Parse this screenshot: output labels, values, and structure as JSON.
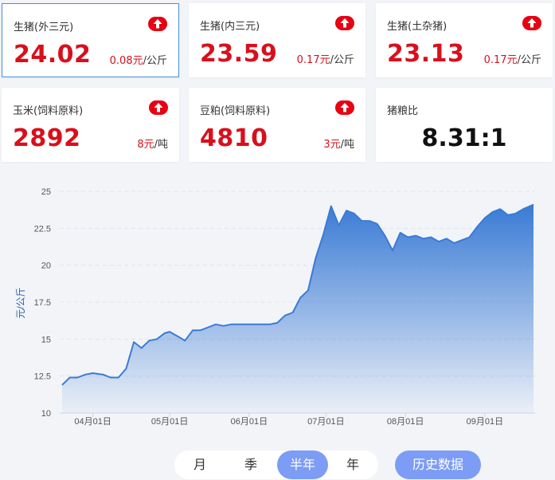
{
  "cards": [
    {
      "name": "生猪(外三元)",
      "price": "24.02",
      "change": "0.08元",
      "unit": "/公斤",
      "trend": "up",
      "selected": true
    },
    {
      "name": "生猪(内三元)",
      "price": "23.59",
      "change": "0.17元",
      "unit": "/公斤",
      "trend": "up"
    },
    {
      "name": "生猪(土杂猪)",
      "price": "23.13",
      "change": "0.17元",
      "unit": "/公斤",
      "trend": "up"
    },
    {
      "name": "玉米(饲料原料)",
      "price": "2892",
      "change": "8元",
      "unit": "/吨",
      "trend": "up"
    },
    {
      "name": "豆粕(饲料原料)",
      "price": "4810",
      "change": "3元",
      "unit": "/吨",
      "trend": "up"
    },
    {
      "name": "猪粮比",
      "ratio": "8.31:1"
    }
  ],
  "colors": {
    "up_red": "#e60012",
    "price_red": "#d8101c",
    "line_blue": "#3a7bd5",
    "accent": "#7c9cf5"
  },
  "chart_data": {
    "type": "area",
    "ylabel": "元/公斤",
    "ylim": [
      10,
      25
    ],
    "yticks": [
      "10",
      "12.5",
      "15",
      "17.5",
      "20",
      "22.5",
      "25"
    ],
    "xticks": [
      "04月01日",
      "05月01日",
      "06月01日",
      "07月01日",
      "08月01日",
      "09月01日"
    ],
    "xtick_dates": [
      "2023-04-01",
      "2023-05-01",
      "2023-06-01",
      "2023-07-01",
      "2023-08-01",
      "2023-09-01"
    ],
    "xlim": [
      "2023-03-20",
      "2023-09-20"
    ],
    "grid": "horizontal dashed",
    "x": [
      "2023-03-20",
      "2023-03-23",
      "2023-03-26",
      "2023-03-29",
      "2023-04-01",
      "2023-04-05",
      "2023-04-08",
      "2023-04-11",
      "2023-04-14",
      "2023-04-17",
      "2023-04-20",
      "2023-04-23",
      "2023-04-26",
      "2023-04-29",
      "2023-05-01",
      "2023-05-04",
      "2023-05-07",
      "2023-05-10",
      "2023-05-13",
      "2023-05-16",
      "2023-05-19",
      "2023-05-22",
      "2023-05-25",
      "2023-05-28",
      "2023-05-31",
      "2023-06-03",
      "2023-06-06",
      "2023-06-09",
      "2023-06-12",
      "2023-06-15",
      "2023-06-18",
      "2023-06-21",
      "2023-06-24",
      "2023-06-27",
      "2023-06-30",
      "2023-07-03",
      "2023-07-06",
      "2023-07-09",
      "2023-07-12",
      "2023-07-15",
      "2023-07-18",
      "2023-07-21",
      "2023-07-24",
      "2023-07-27",
      "2023-07-30",
      "2023-08-02",
      "2023-08-05",
      "2023-08-08",
      "2023-08-11",
      "2023-08-14",
      "2023-08-17",
      "2023-08-20",
      "2023-08-23",
      "2023-08-26",
      "2023-08-29",
      "2023-09-01",
      "2023-09-04",
      "2023-09-07",
      "2023-09-10",
      "2023-09-13",
      "2023-09-16",
      "2023-09-20"
    ],
    "values": [
      11.9,
      12.4,
      12.4,
      12.6,
      12.7,
      12.6,
      12.4,
      12.4,
      13.0,
      14.8,
      14.4,
      14.9,
      15.0,
      15.4,
      15.5,
      15.2,
      14.9,
      15.6,
      15.6,
      15.8,
      16.0,
      15.9,
      16.0,
      16.0,
      16.0,
      16.0,
      16.0,
      16.0,
      16.1,
      16.6,
      16.8,
      17.8,
      18.3,
      20.5,
      22.1,
      24.0,
      22.7,
      23.7,
      23.5,
      23.0,
      23.0,
      22.8,
      22.0,
      21.0,
      22.2,
      21.9,
      22.0,
      21.8,
      21.9,
      21.6,
      21.8,
      21.5,
      21.7,
      21.9,
      22.6,
      23.2,
      23.6,
      23.8,
      23.4,
      23.5,
      23.8,
      24.1
    ]
  },
  "tabs": [
    {
      "label": "月",
      "active": false
    },
    {
      "label": "季",
      "active": false
    },
    {
      "label": "半年",
      "active": true
    },
    {
      "label": "年",
      "active": false
    }
  ],
  "history_button": "历史数据"
}
